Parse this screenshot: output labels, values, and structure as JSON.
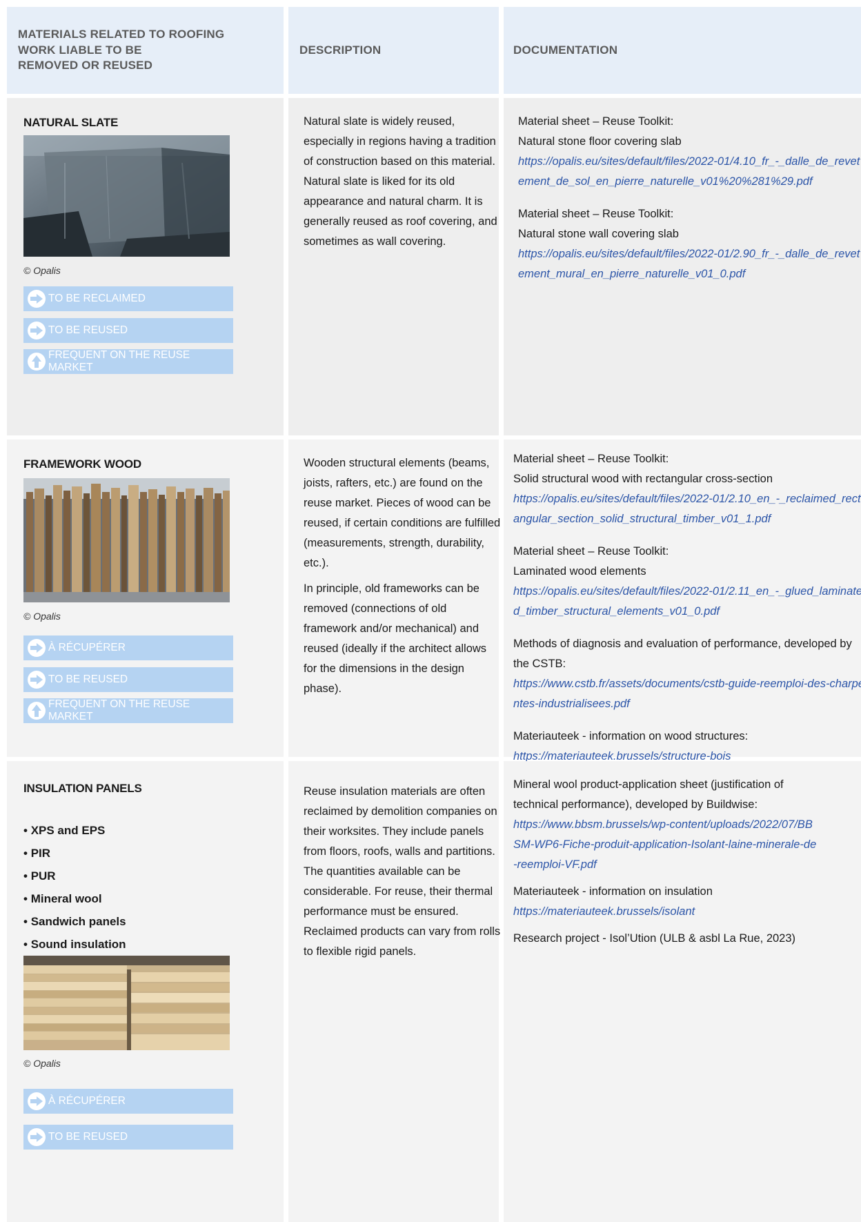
{
  "header": {
    "col1": "MATERIALS RELATED TO ROOFING WORK LIABLE TO BE REMOVED OR REUSED",
    "col1_lines": [
      "MATERIALS RELATED TO ROOFING",
      "WORK LIABLE TO BE",
      "REMOVED OR REUSED"
    ],
    "col2": "DESCRIPTION",
    "col3": "DOCUMENTATION"
  },
  "rows": [
    {
      "title": "NATURAL SLATE",
      "credit": "© Opalis",
      "badges": [
        {
          "label": "TO BE RECLAIMED",
          "icon": "arrow-right-icon"
        },
        {
          "label": "TO BE REUSED",
          "icon": "arrow-right-icon"
        },
        {
          "label": "FREQUENT ON THE REUSE MARKET",
          "icon": "arrow-up-icon"
        }
      ],
      "description": [
        "Natural slate is widely reused, especially in regions having a tradition of construction based on this material. Natural slate is liked for its old appearance and natural charm. It is generally reused as roof covering, and sometimes as wall covering."
      ],
      "docs": [
        {
          "text": [
            "Material sheet – Reuse Toolkit:",
            "Natural stone floor covering slab"
          ],
          "link": "https://opalis.eu/sites/default/files/2022-01/4.10_fr_-_dalle_de_revetement_de_sol_en_pierre_naturelle_v01%20%281%29.pdf"
        },
        {
          "text": [
            "Material sheet – Reuse Toolkit:",
            "Natural stone wall covering slab"
          ],
          "link": "https://opalis.eu/sites/default/files/2022-01/2.90_fr_-_dalle_de_revetement_mural_en_pierre_naturelle_v01_0.pdf"
        }
      ]
    },
    {
      "title": "FRAMEWORK WOOD",
      "credit": "© Opalis",
      "badges": [
        {
          "label": "À RÉCUPÉRER",
          "icon": "arrow-right-icon"
        },
        {
          "label": "TO BE REUSED",
          "icon": "arrow-right-icon"
        },
        {
          "label": "FREQUENT ON THE REUSE MARKET",
          "icon": "arrow-up-icon"
        }
      ],
      "description": [
        "Wooden structural elements (beams, joists, rafters, etc.) are found on the reuse market. Pieces of wood can be reused, if certain conditions are fulfilled (measurements, strength, durability, etc.).",
        "In principle, old frameworks can be removed (connections of old framework and/or mechanical) and reused (ideally if the architect allows for the dimensions in the design phase)."
      ],
      "docs": [
        {
          "text": [
            "Material sheet – Reuse Toolkit:",
            "Solid structural wood with rectangular cross-section"
          ],
          "link": "https://opalis.eu/sites/default/files/2022-01/2.10_en_-_reclaimed_rectangular_section_solid_structural_timber_v01_1.pdf"
        },
        {
          "text": [
            "Material sheet – Reuse Toolkit:",
            "Laminated wood elements"
          ],
          "link": "https://opalis.eu/sites/default/files/2022-01/2.11_en_-_glued_laminated_timber_structural_elements_v01_0.pdf"
        },
        {
          "text": [
            "Methods of diagnosis and evaluation of performance, developed by the CSTB:"
          ],
          "link": "https://www.cstb.fr/assets/documents/cstb-guide-reemploi-des-charpentes-industrialisees.pdf"
        },
        {
          "text": [
            "Materiauteek - information on wood structures:"
          ],
          "link": "https://materiauteek.brussels/structure-bois"
        }
      ]
    },
    {
      "title": "INSULATION PANELS",
      "bullets": [
        "XPS and EPS",
        "PIR",
        "PUR",
        "Mineral wool",
        "Sandwich panels",
        "Sound insulation"
      ],
      "credit": "© Opalis",
      "badges": [
        {
          "label": "À RÉCUPÉRER",
          "icon": "arrow-right-icon"
        },
        {
          "label": "TO BE REUSED",
          "icon": "arrow-right-icon"
        }
      ],
      "description": [
        "Reuse insulation materials are often reclaimed by demolition companies on their worksites. They include panels from floors, roofs, walls and partitions. The quantities available can be considerable. For reuse, their thermal performance must be ensured. Reclaimed products can vary from rolls to flexible rigid panels."
      ],
      "docs": [
        {
          "text": [
            "Mineral wool product-application sheet (justification of technical performance), developed by Buildwise:"
          ],
          "link": "https://www.bbsm.brussels/wp-content/uploads/2022/07/BBSM-WP6-Fiche-produit-application-Isolant-laine-minerale-de-reemploi-VF.pdf"
        },
        {
          "text": [
            "Materiauteek - information on insulation"
          ],
          "link": "https://materiauteek.brussels/isolant"
        },
        {
          "text": [
            "Research project - Isol’Ution (ULB & asbl La Rue, 2023)"
          ],
          "link": ""
        }
      ]
    }
  ],
  "colors": {
    "header_bg": "#e6eef8",
    "cell_bg": "#f3f3f3",
    "badge_bg": "#b5d3f2",
    "link": "#2c55a8"
  }
}
